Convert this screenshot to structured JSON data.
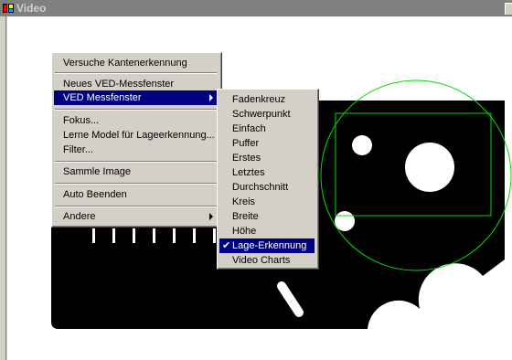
{
  "window": {
    "title": "Video"
  },
  "context_menu": {
    "items": [
      {
        "label": "Versuche Kantenerkennung"
      },
      {
        "label": "Neues VED-Messfenster"
      },
      {
        "label": "VED Messfenster",
        "has_submenu": true,
        "highlighted": true
      },
      {
        "label": "Fokus..."
      },
      {
        "label": "Lerne Model für Lageerkennung..."
      },
      {
        "label": "Filter..."
      },
      {
        "label": "Sammle Image"
      },
      {
        "label": "Auto Beenden"
      },
      {
        "label": "Andere",
        "has_submenu": true
      }
    ]
  },
  "submenu": {
    "items": [
      {
        "label": "Fadenkreuz"
      },
      {
        "label": "Schwerpunkt"
      },
      {
        "label": "Einfach"
      },
      {
        "label": "Puffer"
      },
      {
        "label": "Erstes"
      },
      {
        "label": "Letztes"
      },
      {
        "label": "Durchschnitt"
      },
      {
        "label": "Kreis"
      },
      {
        "label": "Breite"
      },
      {
        "label": "Höhe"
      },
      {
        "label": "Lage-Erkennung",
        "checked": true,
        "highlighted": true
      },
      {
        "label": "Video Charts"
      }
    ]
  },
  "colors": {
    "titlebar_inactive": "#808080",
    "menu_bg": "#d4d0c8",
    "highlight": "#000080",
    "overlay_green": "#00dd00",
    "part_black": "#000000"
  }
}
